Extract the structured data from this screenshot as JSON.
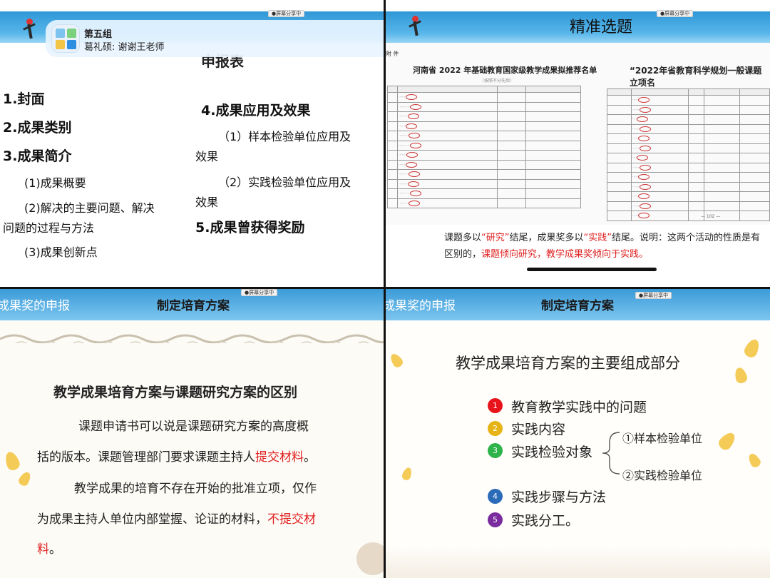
{
  "recording_label": "●屏幕分享中",
  "panel1": {
    "call_name": "第五组",
    "call_message": "葛礼硕: 谢谢王老师",
    "title": "申报表",
    "left_items": [
      "1.封面",
      "2.成果类别",
      "3.成果简介",
      "(1)成果概要",
      "(2)解决的主要问题、解决",
      "问题的过程与方法",
      "(3)成果创新点"
    ],
    "right_items": [
      "4.成果应用及效果",
      "（1）样本检验单位应用及",
      "效果",
      "（2）实践检验单位应用及",
      "效果",
      "5.成果曾获得奖励"
    ]
  },
  "panel2": {
    "title": "精准选题",
    "annex": "附 件",
    "doc_left_title": "河南省 2022 年基础教育国家级教学成果拟推荐名单",
    "doc_left_sub": "（按照不分先后）",
    "doc_right_title": "“2022年省教育科学规划一般课题立项名",
    "caption_1": "课题多以",
    "caption_kw1": "“研究”",
    "caption_2": "结尾，成果奖多以",
    "caption_kw2": "“实践”",
    "caption_3": "结尾。说明：这两个活动的性质是有区别的，",
    "caption_kw3": "课题倾向研究，教学成果奖倾向于实践。",
    "page_num": "— 102 —"
  },
  "panel3": {
    "header_left": "成果奖的申报",
    "header_center": "制定培育方案",
    "heading": "教学成果培育方案与课题研究方案的区别",
    "line1": "课题申请书可以说是课题研究方案的高度概",
    "line2a": "括的版本。课题管理部门要求课题主持人",
    "line2b": "提交材料",
    "line2c": "。",
    "line3": "教学成果的培育不存在开始的批准立项，仅作",
    "line4a": "为成果主持人单位内部堂握、论证的材料，",
    "line4b": "不提交材",
    "line5a": "料",
    "line5b": "。"
  },
  "panel4": {
    "header_left": "成果奖的申报",
    "header_center": "制定培育方案",
    "heading": "教学成果培育方案的主要组成部分",
    "items": [
      {
        "num": "1",
        "label": "教育教学实践中的问题",
        "color": "#e8141c"
      },
      {
        "num": "2",
        "label": "实践内容",
        "color": "#e6b417"
      },
      {
        "num": "3",
        "label": "实践检验对象",
        "color": "#2db34a"
      },
      {
        "num": "4",
        "label": "实践步骤与方法",
        "color": "#2b6bb8"
      },
      {
        "num": "5",
        "label": "实践分工。",
        "color": "#7a2b9e"
      }
    ],
    "sub1": "①样本检验单位",
    "sub2": "②实践检验单位"
  }
}
